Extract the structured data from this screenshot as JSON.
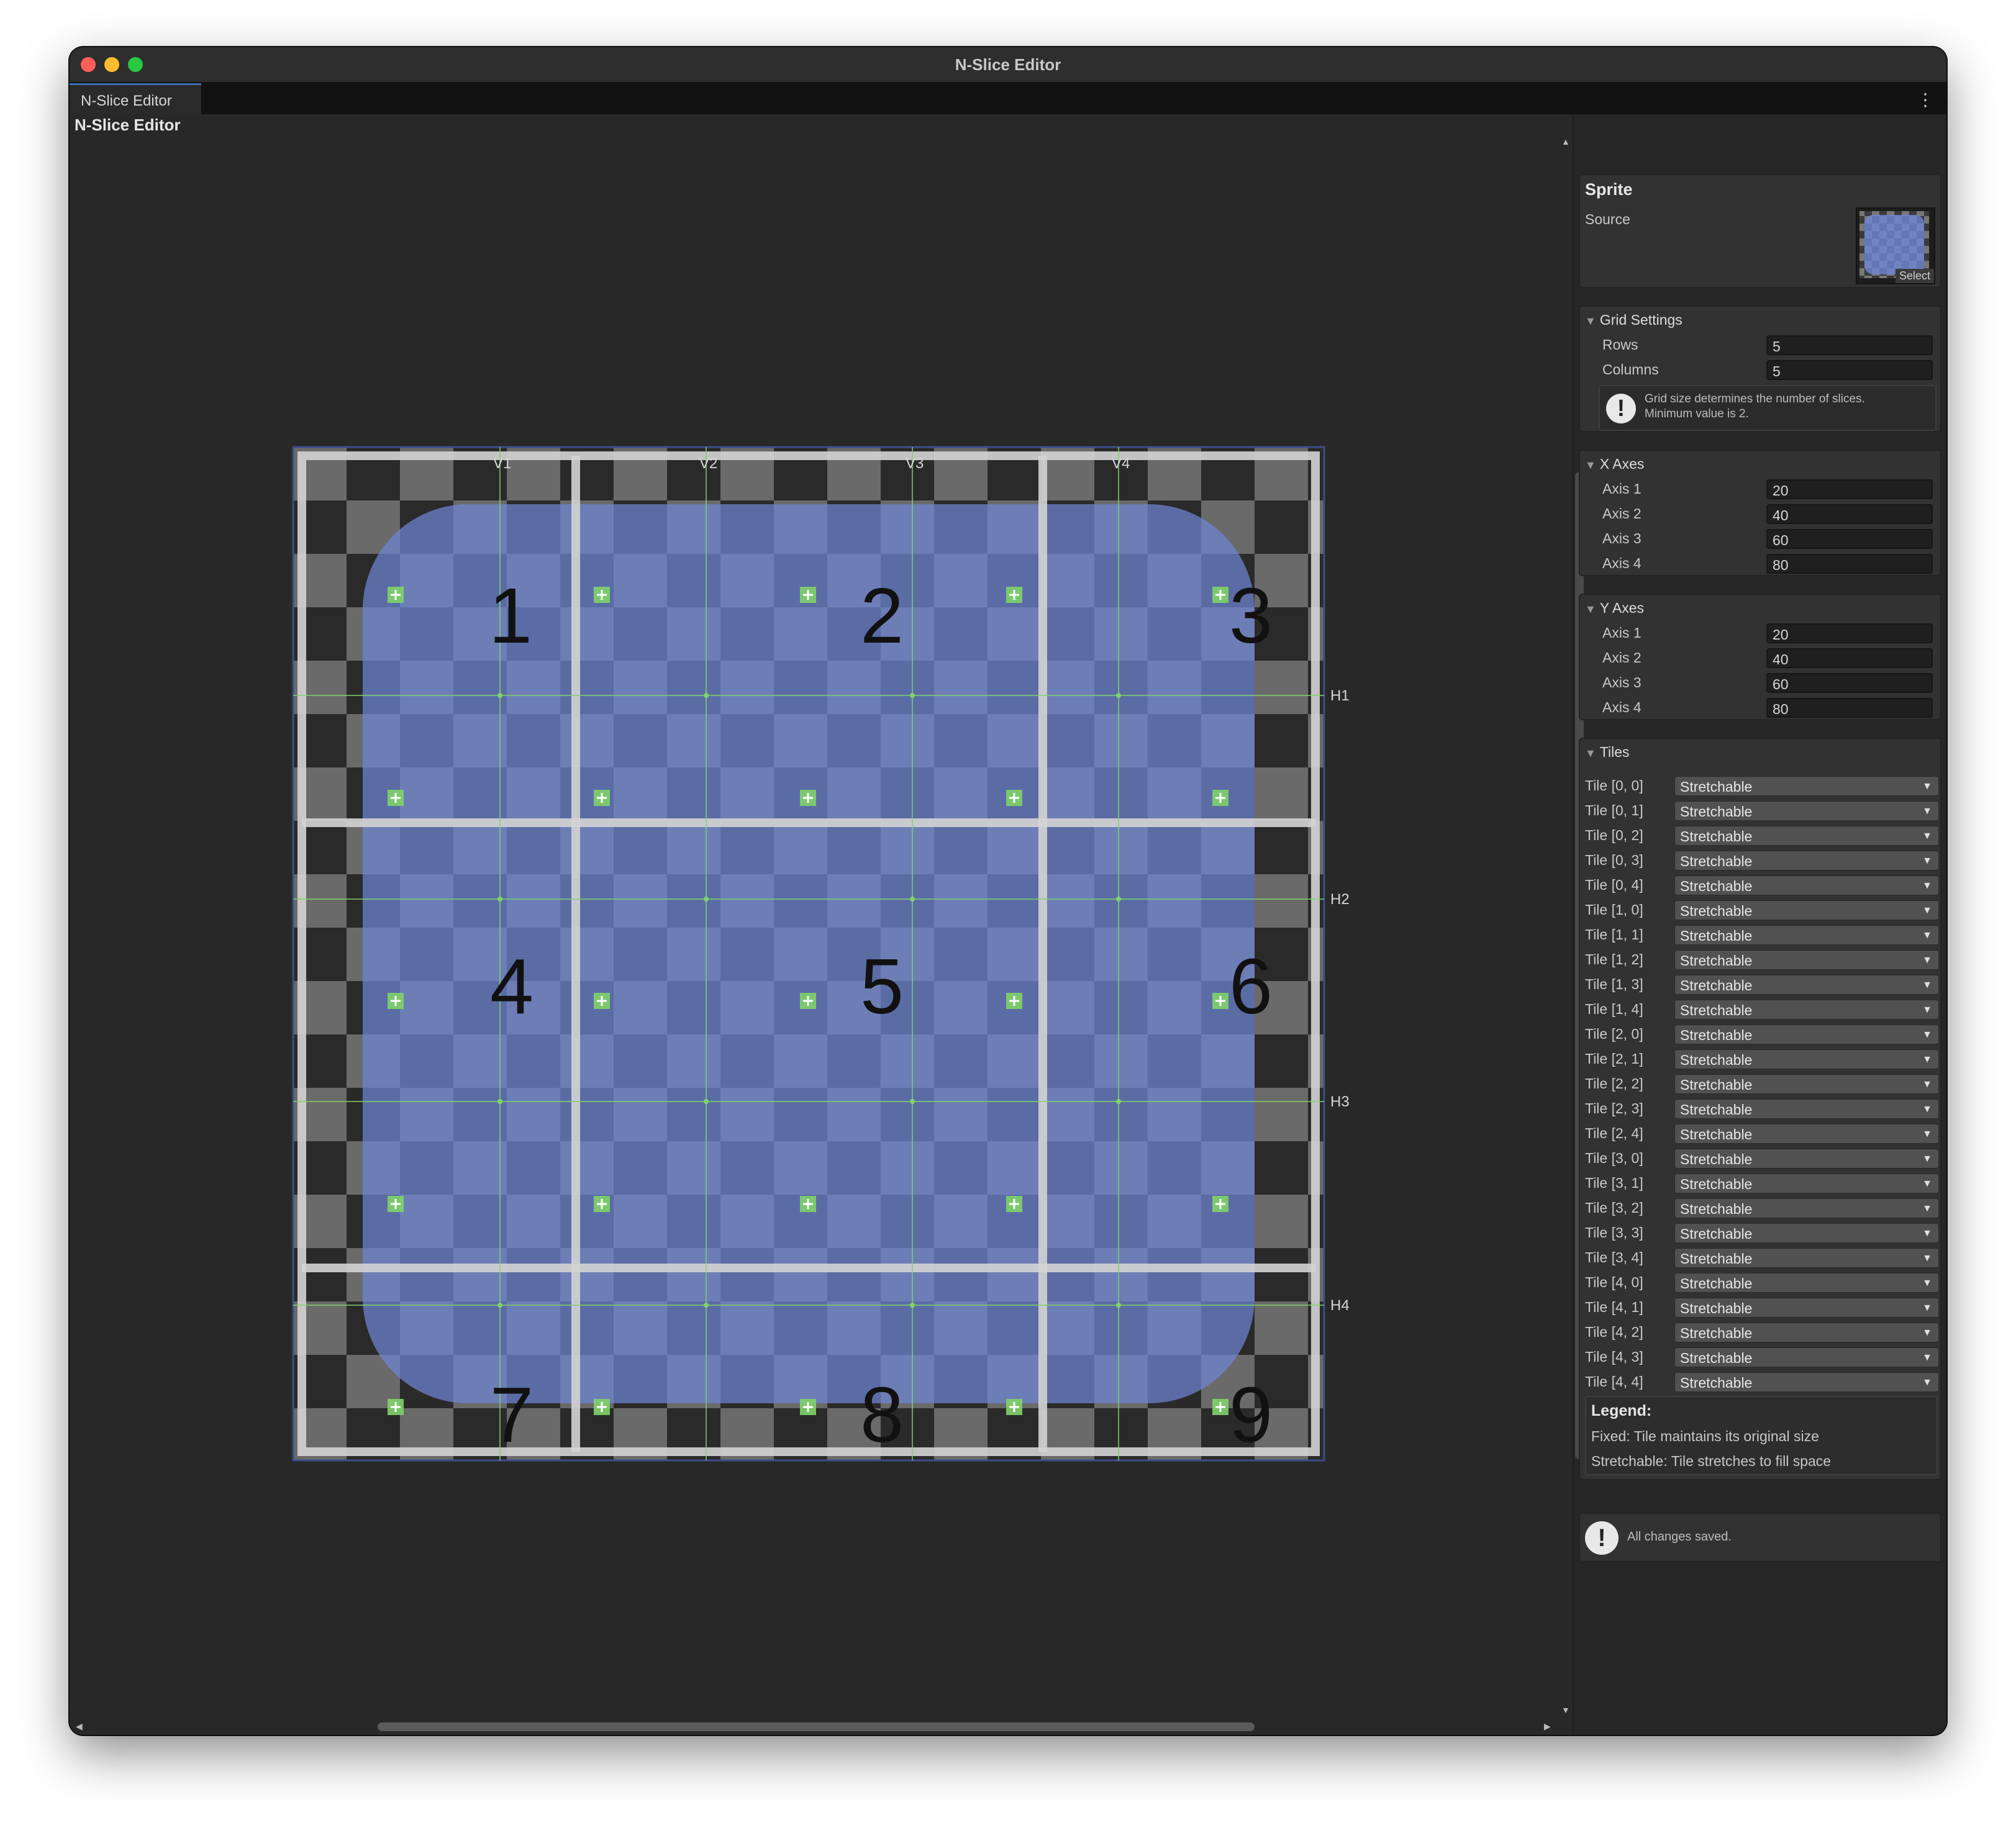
{
  "window": {
    "title": "N-Slice Editor",
    "tab": "N-Slice Editor",
    "toolbar_label": "N-Slice Editor"
  },
  "canvas": {
    "v_labels": [
      "V1",
      "V2",
      "V3",
      "V4"
    ],
    "h_labels": [
      "H1",
      "H2",
      "H3",
      "H4"
    ],
    "slice_numbers": [
      "1",
      "2",
      "3",
      "4",
      "5",
      "6",
      "7",
      "8",
      "9"
    ]
  },
  "sprite": {
    "title": "Sprite",
    "source_label": "Source",
    "select_label": "Select"
  },
  "grid_settings": {
    "title": "Grid Settings",
    "rows_label": "Rows",
    "rows_value": "5",
    "columns_label": "Columns",
    "columns_value": "5",
    "help_line1": "Grid size determines the number of slices.",
    "help_line2": "Minimum value is 2."
  },
  "x_axes": {
    "title": "X Axes",
    "items": [
      {
        "label": "Axis 1",
        "value": "20"
      },
      {
        "label": "Axis 2",
        "value": "40"
      },
      {
        "label": "Axis 3",
        "value": "60"
      },
      {
        "label": "Axis 4",
        "value": "80"
      }
    ]
  },
  "y_axes": {
    "title": "Y Axes",
    "items": [
      {
        "label": "Axis 1",
        "value": "20"
      },
      {
        "label": "Axis 2",
        "value": "40"
      },
      {
        "label": "Axis 3",
        "value": "60"
      },
      {
        "label": "Axis 4",
        "value": "80"
      }
    ]
  },
  "tiles": {
    "title": "Tiles",
    "items": [
      {
        "label": "Tile [0, 0]",
        "value": "Stretchable"
      },
      {
        "label": "Tile [0, 1]",
        "value": "Stretchable"
      },
      {
        "label": "Tile [0, 2]",
        "value": "Stretchable"
      },
      {
        "label": "Tile [0, 3]",
        "value": "Stretchable"
      },
      {
        "label": "Tile [0, 4]",
        "value": "Stretchable"
      },
      {
        "label": "Tile [1, 0]",
        "value": "Stretchable"
      },
      {
        "label": "Tile [1, 1]",
        "value": "Stretchable"
      },
      {
        "label": "Tile [1, 2]",
        "value": "Stretchable"
      },
      {
        "label": "Tile [1, 3]",
        "value": "Stretchable"
      },
      {
        "label": "Tile [1, 4]",
        "value": "Stretchable"
      },
      {
        "label": "Tile [2, 0]",
        "value": "Stretchable"
      },
      {
        "label": "Tile [2, 1]",
        "value": "Stretchable"
      },
      {
        "label": "Tile [2, 2]",
        "value": "Stretchable"
      },
      {
        "label": "Tile [2, 3]",
        "value": "Stretchable"
      },
      {
        "label": "Tile [2, 4]",
        "value": "Stretchable"
      },
      {
        "label": "Tile [3, 0]",
        "value": "Stretchable"
      },
      {
        "label": "Tile [3, 1]",
        "value": "Stretchable"
      },
      {
        "label": "Tile [3, 2]",
        "value": "Stretchable"
      },
      {
        "label": "Tile [3, 3]",
        "value": "Stretchable"
      },
      {
        "label": "Tile [3, 4]",
        "value": "Stretchable"
      },
      {
        "label": "Tile [4, 0]",
        "value": "Stretchable"
      },
      {
        "label": "Tile [4, 1]",
        "value": "Stretchable"
      },
      {
        "label": "Tile [4, 2]",
        "value": "Stretchable"
      },
      {
        "label": "Tile [4, 3]",
        "value": "Stretchable"
      },
      {
        "label": "Tile [4, 4]",
        "value": "Stretchable"
      }
    ]
  },
  "legend": {
    "title": "Legend:",
    "fixed": "Fixed: Tile maintains its original size",
    "stretchable": "Stretchable: Tile stretches to fill space"
  },
  "status": {
    "message": "All changes saved."
  },
  "colors": {
    "accent": "#3a6fb0",
    "sprite_blue": "#6f86d6",
    "guide_green": "#7fd36a",
    "panel": "#323232"
  }
}
